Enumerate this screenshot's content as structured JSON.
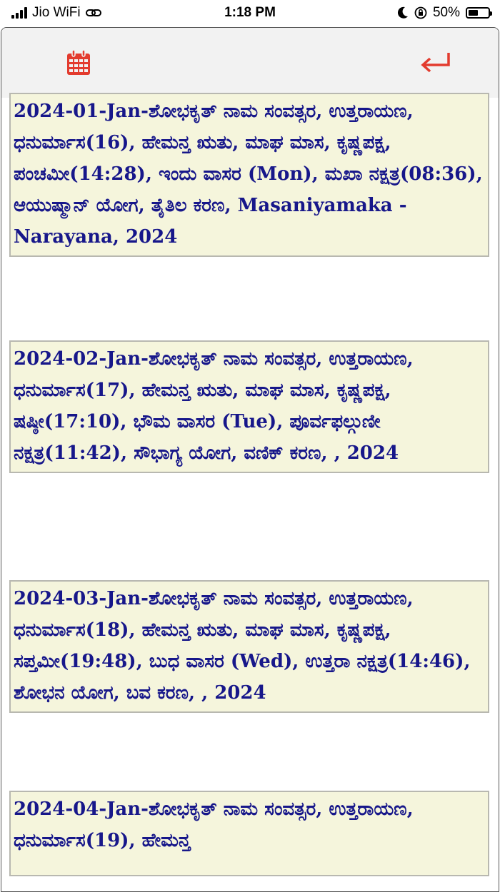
{
  "status_bar": {
    "carrier": "Jio WiFi",
    "time": "1:18 PM",
    "battery": "50%",
    "battery_level": 0.5
  },
  "toolbar": {
    "calendar_icon": "calendar-icon",
    "back_icon": "return-arrow-icon",
    "accent_color": "#e33b2e"
  },
  "entries": [
    "2024-01-Jan-ಶೋಭಕೃತ್ ನಾಮ ಸಂವತ್ಸರ, ಉತ್ತರಾಯಣ, ಧನುರ್ಮಾಸ(16), ಹೇಮನ್ತ ಋತು, ಮಾಘ ಮಾಸ, ಕೃಷ್ಣಪಕ್ಷ, ಪಂಚಮೀ(14:28), ಇಂದು ವಾಸರ (Mon), ಮಖಾ ನಕ್ಷತ್ರ(08:36), ಆಯುಷ್ಮಾನ್ ಯೋಗ, ತೈತಿಲ ಕರಣ, Masaniyamaka - Narayana, 2024",
    "2024-02-Jan-ಶೋಭಕೃತ್ ನಾಮ ಸಂವತ್ಸರ, ಉತ್ತರಾಯಣ, ಧನುರ್ಮಾಸ(17), ಹೇಮನ್ತ ಋತು, ಮಾಘ ಮಾಸ, ಕೃಷ್ಣಪಕ್ಷ, ಷಷ್ಠೀ(17:10), ಭೌಮ ವಾಸರ (Tue), ಪೂರ್ವಫಲ್ಗುಣೀ ನಕ್ಷತ್ರ(11:42), ಸೌಭಾಗ್ಯ ಯೋಗ, ವಣಿಕ್ ಕರಣ, , 2024",
    "2024-03-Jan-ಶೋಭಕೃತ್ ನಾಮ ಸಂವತ್ಸರ, ಉತ್ತರಾಯಣ, ಧನುರ್ಮಾಸ(18), ಹೇಮನ್ತ ಋತು, ಮಾಘ ಮಾಸ, ಕೃಷ್ಣಪಕ್ಷ, ಸಪ್ತಮೀ(19:48), ಬುಧ ವಾಸರ (Wed), ಉತ್ತರಾ ನಕ್ಷತ್ರ(14:46), ಶೋಭನ ಯೋಗ, ಬವ ಕರಣ, , 2024",
    "2024-04-Jan-ಶೋಭಕೃತ್ ನಾಮ ಸಂವತ್ಸರ, ಉತ್ತರಾಯಣ, ಧನುರ್ಮಾಸ(19), ಹೇಮನ್ತ"
  ]
}
